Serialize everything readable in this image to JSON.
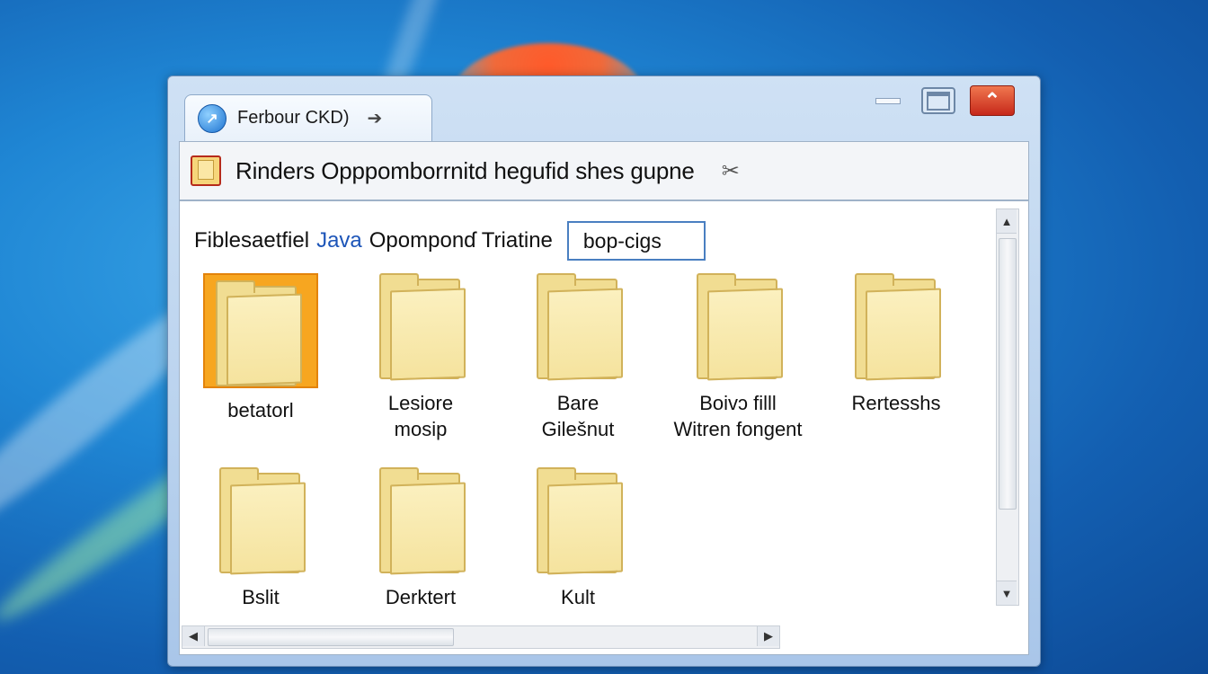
{
  "window": {
    "tab_title": "Ferbour CKD)",
    "tab_arrow": "➔",
    "controls": {
      "minimize": "",
      "maximize": "",
      "close": "⌃"
    }
  },
  "address_bar": {
    "text": "Rinders Opppomborrnitd hegufid shes gupne",
    "tools_icon": "✂"
  },
  "path": {
    "prefix": "Fiblesaetfiel",
    "link": "Java",
    "suffix": "Opomponɗ Triatine",
    "input_value": "bop-cigs"
  },
  "folders": [
    {
      "line1": "betatorl",
      "line2": "",
      "selected": true
    },
    {
      "line1": "Lesiore",
      "line2": "mosip",
      "selected": false
    },
    {
      "line1": "Bare",
      "line2": "Gilešnut",
      "selected": false
    },
    {
      "line1": "Boivɔ filll",
      "line2": "Witren fongent",
      "selected": false
    },
    {
      "line1": "Rertesshs",
      "line2": "",
      "selected": false
    },
    {
      "line1": "Bslit",
      "line2": "",
      "selected": false
    },
    {
      "line1": "Derktert",
      "line2": "",
      "selected": false
    },
    {
      "line1": "Kult",
      "line2": "",
      "selected": false
    }
  ],
  "scrollbars": {
    "up": "▲",
    "down": "▼",
    "left": "◀",
    "right": "▶"
  },
  "colors": {
    "selection": "#f7a620",
    "link": "#1d55b8",
    "close_button": "#c6281a"
  }
}
